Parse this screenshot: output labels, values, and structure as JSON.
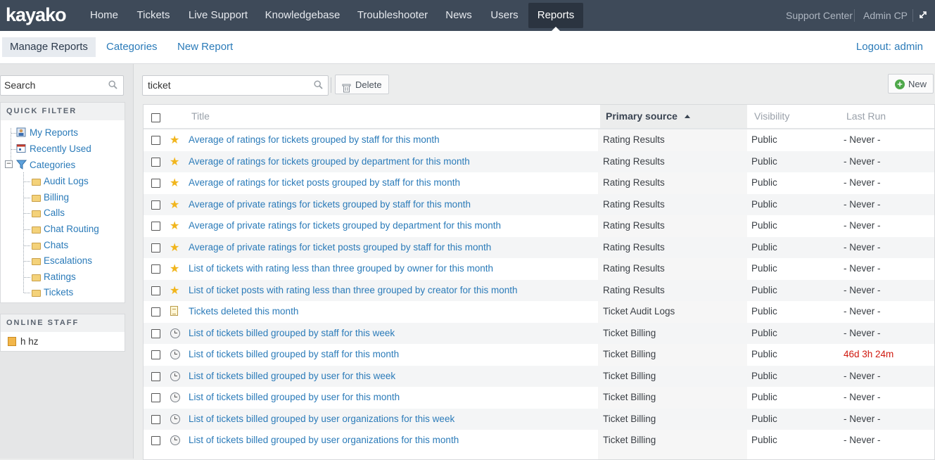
{
  "app": {
    "logo": "kayako"
  },
  "nav": {
    "items": [
      "Home",
      "Tickets",
      "Live Support",
      "Knowledgebase",
      "Troubleshooter",
      "News",
      "Users",
      "Reports"
    ],
    "active": "Reports",
    "right": {
      "support_center": "Support Center",
      "admin_cp": "Admin CP",
      "expand_icon": "expand-icon"
    }
  },
  "subnav": {
    "tabs": [
      "Manage Reports",
      "Categories",
      "New Report"
    ],
    "active": "Manage Reports",
    "logout": "Logout: admin"
  },
  "sidebar": {
    "search_value": "Search",
    "quick_filter": {
      "heading": "QUICK FILTER",
      "items": [
        {
          "label": "My Reports",
          "icon": "my-reports-icon"
        },
        {
          "label": "Recently Used",
          "icon": "calendar-icon"
        },
        {
          "label": "Categories",
          "icon": "filter-icon"
        }
      ],
      "categories": [
        "Audit Logs",
        "Billing",
        "Calls",
        "Chat Routing",
        "Chats",
        "Escalations",
        "Ratings",
        "Tickets"
      ]
    },
    "online_staff": {
      "heading": "ONLINE STAFF",
      "members": [
        "h hz"
      ]
    }
  },
  "toolbar": {
    "search_value": "ticket",
    "delete_label": "Delete",
    "new_label": "New"
  },
  "table": {
    "columns": {
      "title": "Title",
      "source": "Primary source",
      "visibility": "Visibility",
      "last_run": "Last Run"
    },
    "sorted_column": "Primary source",
    "rows": [
      {
        "icon": "star",
        "title": "Average of ratings for tickets grouped by staff for this month",
        "source": "Rating Results",
        "visibility": "Public",
        "last_run": "- Never -"
      },
      {
        "icon": "star",
        "title": "Average of ratings for tickets grouped by department for this month",
        "source": "Rating Results",
        "visibility": "Public",
        "last_run": "- Never -"
      },
      {
        "icon": "star",
        "title": "Average of ratings for ticket posts grouped by staff for this month",
        "source": "Rating Results",
        "visibility": "Public",
        "last_run": "- Never -"
      },
      {
        "icon": "star",
        "title": "Average of private ratings for tickets grouped by staff for this month",
        "source": "Rating Results",
        "visibility": "Public",
        "last_run": "- Never -"
      },
      {
        "icon": "star",
        "title": "Average of private ratings for tickets grouped by department for this month",
        "source": "Rating Results",
        "visibility": "Public",
        "last_run": "- Never -"
      },
      {
        "icon": "star",
        "title": "Average of private ratings for ticket posts grouped by staff for this month",
        "source": "Rating Results",
        "visibility": "Public",
        "last_run": "- Never -"
      },
      {
        "icon": "star",
        "title": "List of tickets with rating less than three grouped by owner for this month",
        "source": "Rating Results",
        "visibility": "Public",
        "last_run": "- Never -"
      },
      {
        "icon": "star",
        "title": "List of ticket posts with rating less than three grouped by creator for this month",
        "source": "Rating Results",
        "visibility": "Public",
        "last_run": "- Never -"
      },
      {
        "icon": "document",
        "title": "Tickets deleted this month",
        "source": "Ticket Audit Logs",
        "visibility": "Public",
        "last_run": "- Never -"
      },
      {
        "icon": "clock",
        "title": "List of tickets billed grouped by staff for this week",
        "source": "Ticket Billing",
        "visibility": "Public",
        "last_run": "- Never -"
      },
      {
        "icon": "clock",
        "title": "List of tickets billed grouped by staff for this month",
        "source": "Ticket Billing",
        "visibility": "Public",
        "last_run": "46d 3h 24m",
        "last_run_color": "#d0190f"
      },
      {
        "icon": "clock",
        "title": "List of tickets billed grouped by user for this week",
        "source": "Ticket Billing",
        "visibility": "Public",
        "last_run": "- Never -"
      },
      {
        "icon": "clock",
        "title": "List of tickets billed grouped by user for this month",
        "source": "Ticket Billing",
        "visibility": "Public",
        "last_run": "- Never -"
      },
      {
        "icon": "clock",
        "title": "List of tickets billed grouped by user organizations for this week",
        "source": "Ticket Billing",
        "visibility": "Public",
        "last_run": "- Never -"
      },
      {
        "icon": "clock",
        "title": "List of tickets billed grouped by user organizations for this month",
        "source": "Ticket Billing",
        "visibility": "Public",
        "last_run": "- Never -"
      }
    ]
  },
  "colors": {
    "topbar": "#3e4a59",
    "link": "#2b7bb9",
    "alert": "#d0190f"
  }
}
